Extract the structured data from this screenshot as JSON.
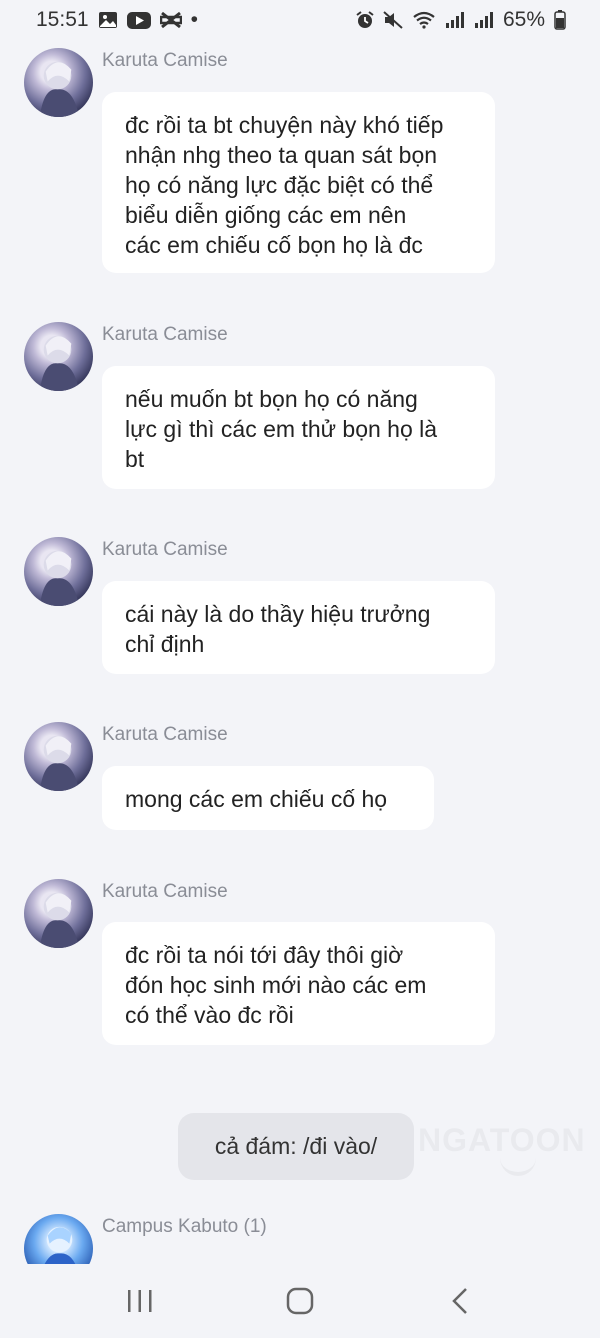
{
  "status_bar": {
    "time": "15:51",
    "battery": "65%",
    "dot": "•"
  },
  "messages": [
    {
      "sender": "Karuta Camise",
      "text": "đc rồi ta bt chuyện này khó tiếp\nnhận nhg theo ta quan sát bọn\nhọ có năng lực đặc biệt có thể\nbiểu diễn giống các em nên\ncác em chiếu cố bọn họ là đc"
    },
    {
      "sender": "Karuta Camise",
      "text": "nếu muốn bt bọn họ có năng\nlực gì thì các em thử bọn họ là\nbt"
    },
    {
      "sender": "Karuta Camise",
      "text": "cái này là do thầy hiệu trưởng\nchỉ định"
    },
    {
      "sender": "Karuta Camise",
      "text": "mong các em chiếu cố họ"
    },
    {
      "sender": "Karuta Camise",
      "text": "đc rồi ta nói tới đây thôi giờ\nđón học sinh mới nào các em\ncó thể vào đc rồi"
    }
  ],
  "narration": "cả đám: /đi vào/",
  "watermark": "NGATOON",
  "last_message": {
    "sender": "Campus Kabuto (1)"
  },
  "icons": {
    "gallery": "image-icon",
    "youtube": "youtube-icon",
    "capcut": "capcut-icon",
    "alarm": "alarm-icon",
    "mute": "mute-icon",
    "wifi": "wifi-icon",
    "signal": "signal-icon",
    "battery": "battery-icon",
    "recents": "recents-icon",
    "home": "home-icon",
    "back": "back-icon"
  }
}
